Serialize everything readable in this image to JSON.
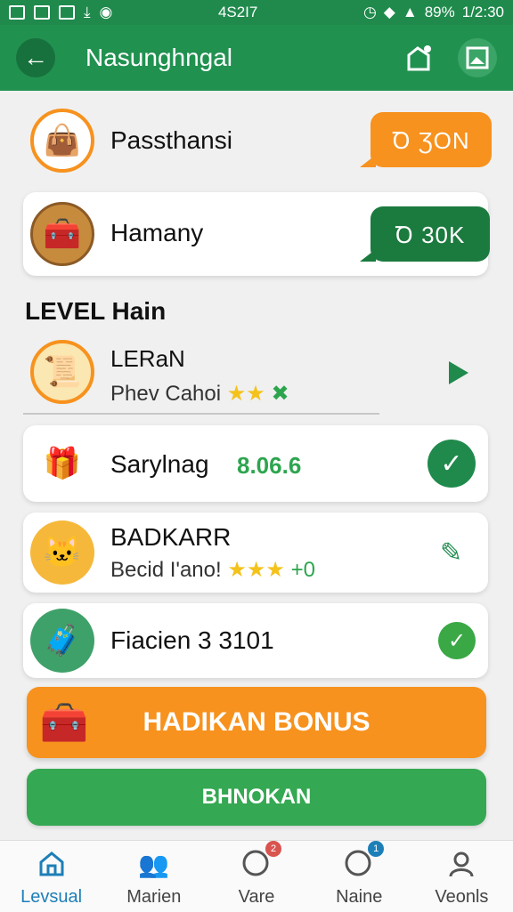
{
  "status_bar": {
    "time": "1/2:30",
    "center": "4S2I7",
    "battery": "89%"
  },
  "app_bar": {
    "title": "Nasunghngal"
  },
  "top_cards": [
    {
      "title": "Passthansi",
      "bubble": "Ꝺ ƷON",
      "bubble_color": "#f7921e"
    },
    {
      "title": "Hamany",
      "bubble": "Ꝺ 30K",
      "bubble_color": "#1b7a3e"
    }
  ],
  "section": {
    "title": "LEVEL Hain"
  },
  "levels": [
    {
      "title": "LERaN",
      "subtitle": "Phev Cahoi",
      "stars": "★★",
      "extra": "✖"
    },
    {
      "title": "Sarylnag",
      "amount": "8.06.6"
    },
    {
      "title": "BADKARR",
      "subtitle": "Becid I'ano!",
      "stars": "★★★",
      "extra": "+0"
    },
    {
      "title": "Fiacien 3 3101"
    }
  ],
  "buttons": {
    "bonus": "HADIKAN BONUS",
    "secondary": "BHNOKAN"
  },
  "bottom_nav": [
    {
      "label": "Levsual",
      "icon": "home-icon"
    },
    {
      "label": "Marien",
      "icon": "people-icon"
    },
    {
      "label": "Vare",
      "icon": "search-icon",
      "badge": "2"
    },
    {
      "label": "Naine",
      "icon": "search-icon",
      "badge": "1"
    },
    {
      "label": "Veonls",
      "icon": "user-icon"
    }
  ]
}
